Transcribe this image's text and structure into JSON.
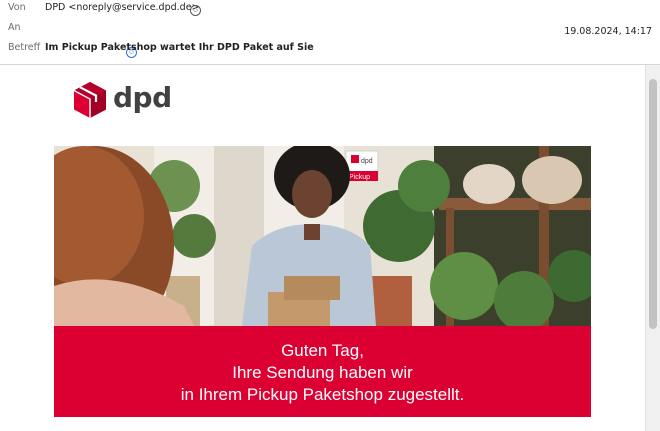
{
  "header": {
    "from_label": "Von",
    "from_value": "DPD <noreply@service.dpd.de>",
    "to_label": "An",
    "date": "19.08.2024, 14:17",
    "subject_label": "Betreff",
    "subject_value": "Im Pickup Paketshop wartet Ihr DPD Paket auf Sie"
  },
  "logo": {
    "text": "dpd",
    "brand_color": "#dc0032"
  },
  "hero": {
    "sign_brand": "dpd",
    "sign_label": "Pickup"
  },
  "banner": {
    "line1": "Guten Tag,",
    "line2": "Ihre Sendung haben wir",
    "line3": "in Ihrem Pickup Paketshop zugestellt.",
    "color": "#dc0032"
  },
  "icons": [
    "contact-icon",
    "recipient-icon",
    "dpd-cube-icon"
  ]
}
